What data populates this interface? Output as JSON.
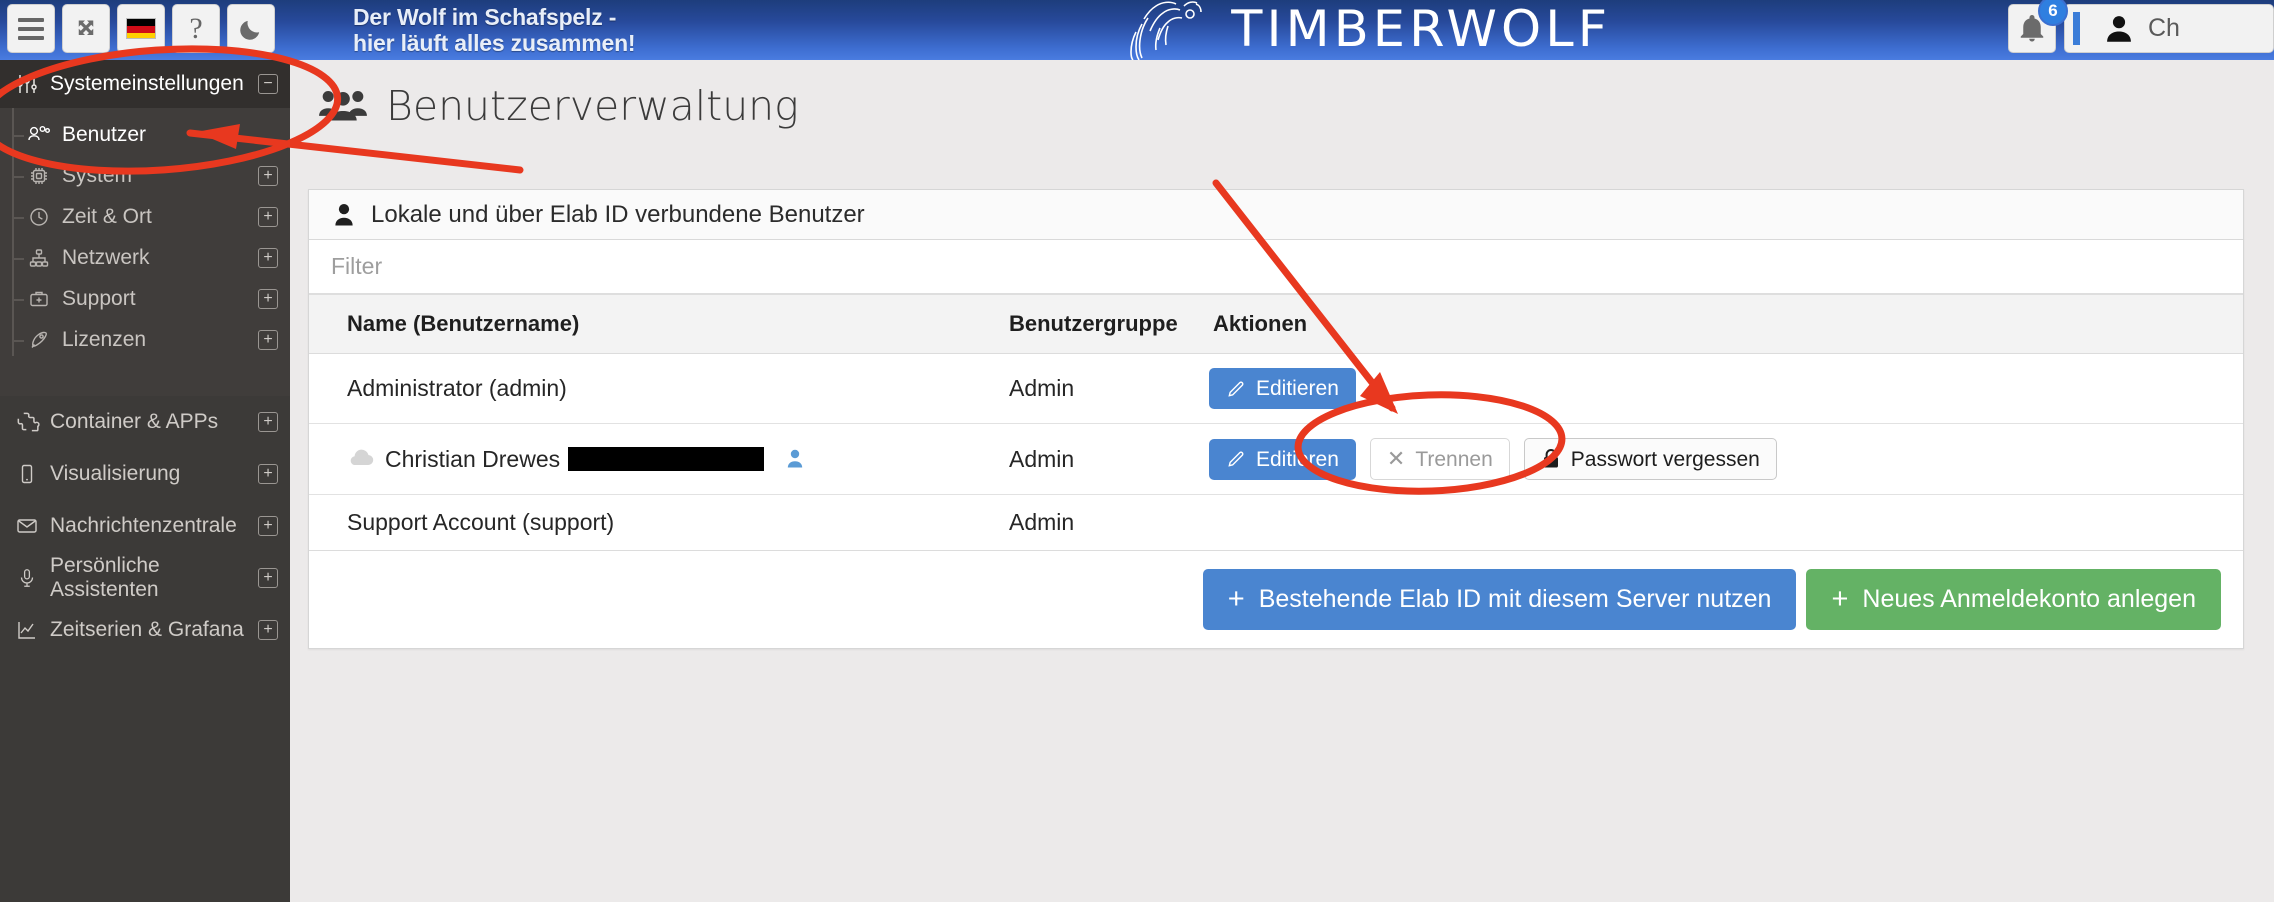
{
  "topbar": {
    "buttons": [
      {
        "name": "menu-button",
        "icon": "hamburger-icon",
        "label": ""
      },
      {
        "name": "fullscreen-button",
        "icon": "arrows-expand-icon",
        "label": ""
      },
      {
        "name": "language-button",
        "icon": "german-flag-icon",
        "label": ""
      },
      {
        "name": "help-button",
        "icon": "question-mark-icon",
        "label": "?"
      },
      {
        "name": "dark-mode-button",
        "icon": "moon-icon",
        "label": ""
      }
    ],
    "motto_line1": "Der Wolf im Schafspelz -",
    "motto_line2": "hier läuft alles zusammen!",
    "logo_text": "TIMBERWOLF",
    "notification_count": "6",
    "user_name": "Ch",
    "accent_blue": "#3d6dd0"
  },
  "sidebar": {
    "section": {
      "label": "Systemeinstellungen",
      "icon": "sliders-icon",
      "toggle": "−"
    },
    "subitems": [
      {
        "label": "Benutzer",
        "icon": "users-icon",
        "expander": "",
        "active": true
      },
      {
        "label": "System",
        "icon": "cpu-chip-icon",
        "expander": "+",
        "active": false
      },
      {
        "label": "Zeit & Ort",
        "icon": "clock-icon",
        "expander": "+",
        "active": false
      },
      {
        "label": "Netzwerk",
        "icon": "network-icon",
        "expander": "+",
        "active": false
      },
      {
        "label": "Support",
        "icon": "medkit-icon",
        "expander": "+",
        "active": false
      },
      {
        "label": "Lizenzen",
        "icon": "rocket-icon",
        "expander": "+",
        "active": false
      }
    ],
    "topitems": [
      {
        "label": "Container & APPs",
        "icon": "puzzle-icon",
        "expander": "+"
      },
      {
        "label": "Visualisierung",
        "icon": "mobile-icon",
        "expander": "+"
      },
      {
        "label": "Nachrichtenzentrale",
        "icon": "envelope-icon",
        "expander": "+"
      },
      {
        "label": "Persönliche Assistenten",
        "icon": "microphone-icon",
        "expander": "+"
      },
      {
        "label": "Zeitserien & Grafana",
        "icon": "chart-line-icon",
        "expander": "+"
      }
    ]
  },
  "main": {
    "page_title": "Benutzerverwaltung",
    "page_title_icon": "users-group-icon",
    "card_title": "Lokale und über Elab ID verbundene Benutzer",
    "card_title_icon": "person-icon",
    "filter_placeholder": "Filter",
    "filter_value": "",
    "columns": [
      "Name (Benutzername)",
      "Benutzergruppe",
      "Aktionen"
    ],
    "rows": [
      {
        "name": "Administrator (admin)",
        "group": "Admin",
        "has_cloud_icon": false,
        "has_redaction": false,
        "has_person_badge": false,
        "actions": [
          {
            "label": "Editieren",
            "icon": "pencil-icon",
            "style": "primary"
          }
        ]
      },
      {
        "name": "Christian Drewes",
        "group": "Admin",
        "has_cloud_icon": true,
        "has_redaction": true,
        "has_person_badge": true,
        "actions": [
          {
            "label": "Editieren",
            "icon": "pencil-icon",
            "style": "primary"
          },
          {
            "label": "Trennen",
            "icon": "x-icon",
            "style": "ghost"
          },
          {
            "label": "Passwort vergessen",
            "icon": "lock-icon",
            "style": "light"
          }
        ]
      },
      {
        "name": "Support Account (support)",
        "group": "Admin",
        "has_cloud_icon": false,
        "has_redaction": false,
        "has_person_badge": false,
        "actions": []
      }
    ],
    "footer_buttons": [
      {
        "label": "Bestehende Elab ID mit diesem Server nutzen",
        "icon": "plus-icon",
        "style": "blue"
      },
      {
        "label": "Neues Anmeldekonto anlegen",
        "icon": "plus-icon",
        "style": "green"
      }
    ]
  },
  "annotations": {
    "color": "#e8381f",
    "shapes": [
      "ellipse-around-benutzer-menu",
      "arrow-to-benutzer-menu",
      "arrow-to-passwort-vergessen",
      "ellipse-around-passwort-vergessen"
    ]
  }
}
